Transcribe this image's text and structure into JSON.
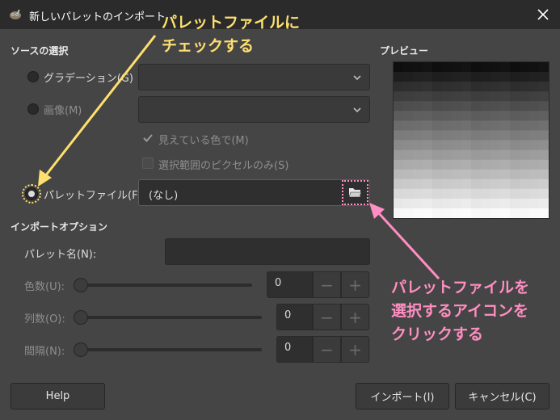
{
  "window": {
    "title": "新しいパレットのインポート"
  },
  "source": {
    "section_label": "ソースの選択",
    "gradient_label": "グラデーション(G)",
    "image_label": "画像(M)",
    "visible_colors_label": "見えている色で(M)",
    "selected_pixels_label": "選択範囲のピクセルのみ(S)",
    "palette_file_label": "パレットファイル(F)",
    "palette_file_value": "(なし)"
  },
  "import_options": {
    "section_label": "インポートオプション",
    "palette_name_label": "パレット名(N):",
    "palette_name_value": "",
    "colors_label": "色数(U):",
    "colors_value": "0",
    "columns_label": "列数(O):",
    "columns_value": "0",
    "interval_label": "間隔(N):",
    "interval_value": "0"
  },
  "preview": {
    "label": "プレビュー"
  },
  "buttons": {
    "help": "Help",
    "import": "インポート(I)",
    "cancel": "キャンセル(C)"
  },
  "annotations": {
    "yellow_callout": "パレットファイルに\nチェックする",
    "pink_callout": "パレットファイルを\n選択するアイコンを\nクリックする"
  },
  "colors": {
    "window_bg": "#454545",
    "titlebar_bg": "#2b2b2b",
    "yellow_callout": "#ffe06e",
    "pink_callout": "#ff8ec2"
  }
}
